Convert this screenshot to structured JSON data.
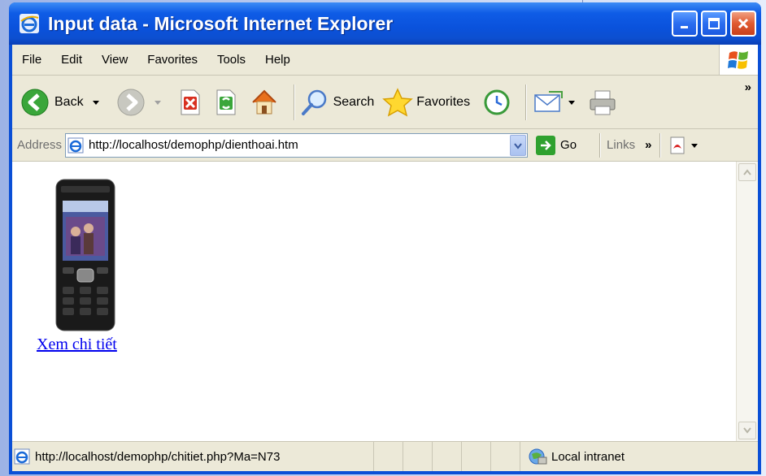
{
  "window": {
    "title": "Input data - Microsoft Internet Explorer"
  },
  "menu": {
    "items": [
      "File",
      "Edit",
      "View",
      "Favorites",
      "Tools",
      "Help"
    ]
  },
  "toolbar": {
    "back_label": "Back",
    "search_label": "Search",
    "favorites_label": "Favorites"
  },
  "address": {
    "label": "Address",
    "url": "http://localhost/demophp/dienthoai.htm",
    "go_label": "Go",
    "links_label": "Links"
  },
  "content": {
    "link_text": "Xem chi tiết"
  },
  "status": {
    "url": "http://localhost/demophp/chitiet.php?Ma=N73",
    "zone": "Local intranet"
  },
  "colors": {
    "titlebar": "#0a52dc",
    "chrome": "#ece9d8",
    "link": "#0000ee"
  }
}
